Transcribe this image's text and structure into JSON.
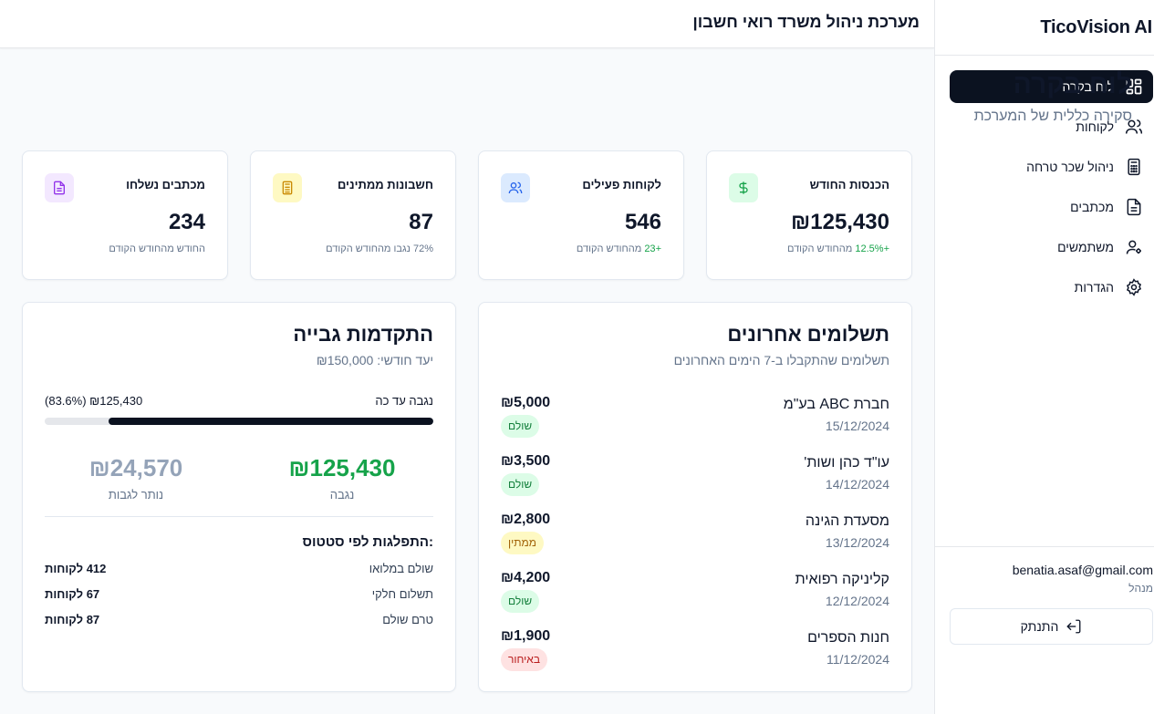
{
  "topbar": {
    "title": "מערכת ניהול משרד רואי חשבון"
  },
  "sidebar": {
    "brand": "TicoVision AI",
    "items": [
      {
        "label": "לוח בקרה",
        "icon": "dashboard-icon",
        "active": true
      },
      {
        "label": "לקוחות",
        "icon": "users-icon"
      },
      {
        "label": "ניהול שכר טרחה",
        "icon": "calculator-icon"
      },
      {
        "label": "מכתבים",
        "icon": "file-text-icon"
      },
      {
        "label": "משתמשים",
        "icon": "user-cog-icon"
      },
      {
        "label": "הגדרות",
        "icon": "gear-icon"
      }
    ],
    "user": {
      "email": "benatia.asaf@gmail.com",
      "role": "מנהל",
      "logout_label": "התנתק"
    }
  },
  "page": {
    "title": "לוח בקרה",
    "subtitle": "סקירה כללית של המערכת"
  },
  "stats": [
    {
      "label": "הכנסות החודש",
      "value": "₪125,430",
      "change": "+12.5%",
      "sub": "מהחודש הקודם",
      "icon": "dollar-icon",
      "accent": "#16a34a",
      "bg": "#dcfce7"
    },
    {
      "label": "לקוחות פעילים",
      "value": "546",
      "change": "+23",
      "sub": "מהחודש הקודם",
      "icon": "users-icon",
      "accent": "#2563eb",
      "bg": "#dbeafe"
    },
    {
      "label": "חשבונות ממתינים",
      "value": "87",
      "change": "",
      "sub": "72% נגבו מהחודש הקודם",
      "icon": "calculator-icon",
      "accent": "#ca8a04",
      "bg": "#fef9c3"
    },
    {
      "label": "מכתבים נשלחו",
      "value": "234",
      "change": "",
      "sub": "החודש מהחודש הקודם",
      "icon": "file-text-icon",
      "accent": "#9333ea",
      "bg": "#f3e8ff"
    }
  ],
  "payments": {
    "title": "תשלומים אחרונים",
    "subtitle": "תשלומים שהתקבלו ב-7 הימים האחרונים",
    "rows": [
      {
        "name": "חברת ABC בע\"מ",
        "date": "15/12/2024",
        "amount": "₪5,000",
        "status": "שולם",
        "kind": "paid"
      },
      {
        "name": "עו\"ד כהן ושות'",
        "date": "14/12/2024",
        "amount": "₪3,500",
        "status": "שולם",
        "kind": "paid"
      },
      {
        "name": "מסעדת הגינה",
        "date": "13/12/2024",
        "amount": "₪2,800",
        "status": "ממתין",
        "kind": "pend"
      },
      {
        "name": "קליניקה רפואית",
        "date": "12/12/2024",
        "amount": "₪4,200",
        "status": "שולם",
        "kind": "paid"
      },
      {
        "name": "חנות הספרים",
        "date": "11/12/2024",
        "amount": "₪1,900",
        "status": "באיחור",
        "kind": "late"
      }
    ]
  },
  "collection": {
    "title": "התקדמות גבייה",
    "goal": "יעד חודשי: ₪150,000",
    "progress_label": "נגבה עד כה",
    "progress_value": "₪125,430 (83.6%)",
    "progress_fraction": 0.836,
    "collected_value": "₪125,430",
    "collected_label": "נגבה",
    "remaining_value": "₪24,570",
    "remaining_label": "נותר לגבות",
    "collected_color": "#16a34a",
    "remaining_color": "#94a3b8",
    "dist_title": "התפלגות לפי סטטוס:",
    "dist": [
      {
        "label": "שולם במלואו",
        "value": "412 לקוחות"
      },
      {
        "label": "תשלום חלקי",
        "value": "67 לקוחות"
      },
      {
        "label": "טרם שולם",
        "value": "87 לקוחות"
      }
    ]
  }
}
